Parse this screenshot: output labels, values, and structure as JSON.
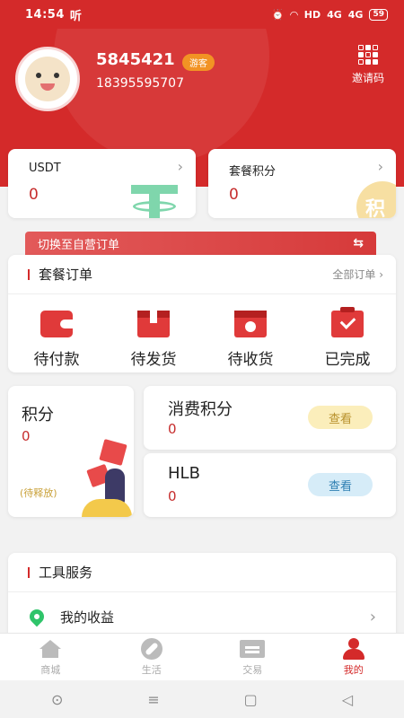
{
  "status_bar": {
    "time": "14:54",
    "carrier": "听",
    "network": "HD",
    "signal1": "4G",
    "signal2": "4G",
    "battery": "59"
  },
  "profile": {
    "username": "5845421",
    "badge": "游客",
    "phone": "18395595707",
    "invite_label": "邀请码"
  },
  "assets": [
    {
      "name": "USDT",
      "value": "0"
    },
    {
      "name": "套餐积分",
      "value": "0",
      "badge_char": "积"
    }
  ],
  "switch_banner": {
    "label": "切换至自营订单",
    "icon": "⇆"
  },
  "orders": {
    "title": "套餐订单",
    "more": "全部订单 ›",
    "items": [
      {
        "label": "待付款",
        "icon": "wallet-icon"
      },
      {
        "label": "待发货",
        "icon": "box-icon"
      },
      {
        "label": "待收货",
        "icon": "clock-icon"
      },
      {
        "label": "已完成",
        "icon": "done-icon"
      }
    ]
  },
  "points": {
    "title": "积分",
    "value": "0",
    "note": "(待释放)"
  },
  "scores": [
    {
      "title": "消费积分",
      "value": "0",
      "button": "查看"
    },
    {
      "title": "HLB",
      "value": "0",
      "button": "查看"
    }
  ],
  "tools": {
    "title": "工具服务",
    "items": [
      {
        "label": "我的收益"
      }
    ]
  },
  "bottom_nav": [
    {
      "label": "商城"
    },
    {
      "label": "生活"
    },
    {
      "label": "交易"
    },
    {
      "label": "我的"
    }
  ],
  "colors": {
    "primary": "#d42a2a",
    "value_red": "#c62d2d",
    "yellow_btn": "#fbeebb",
    "blue_btn": "#d6ecf8"
  }
}
